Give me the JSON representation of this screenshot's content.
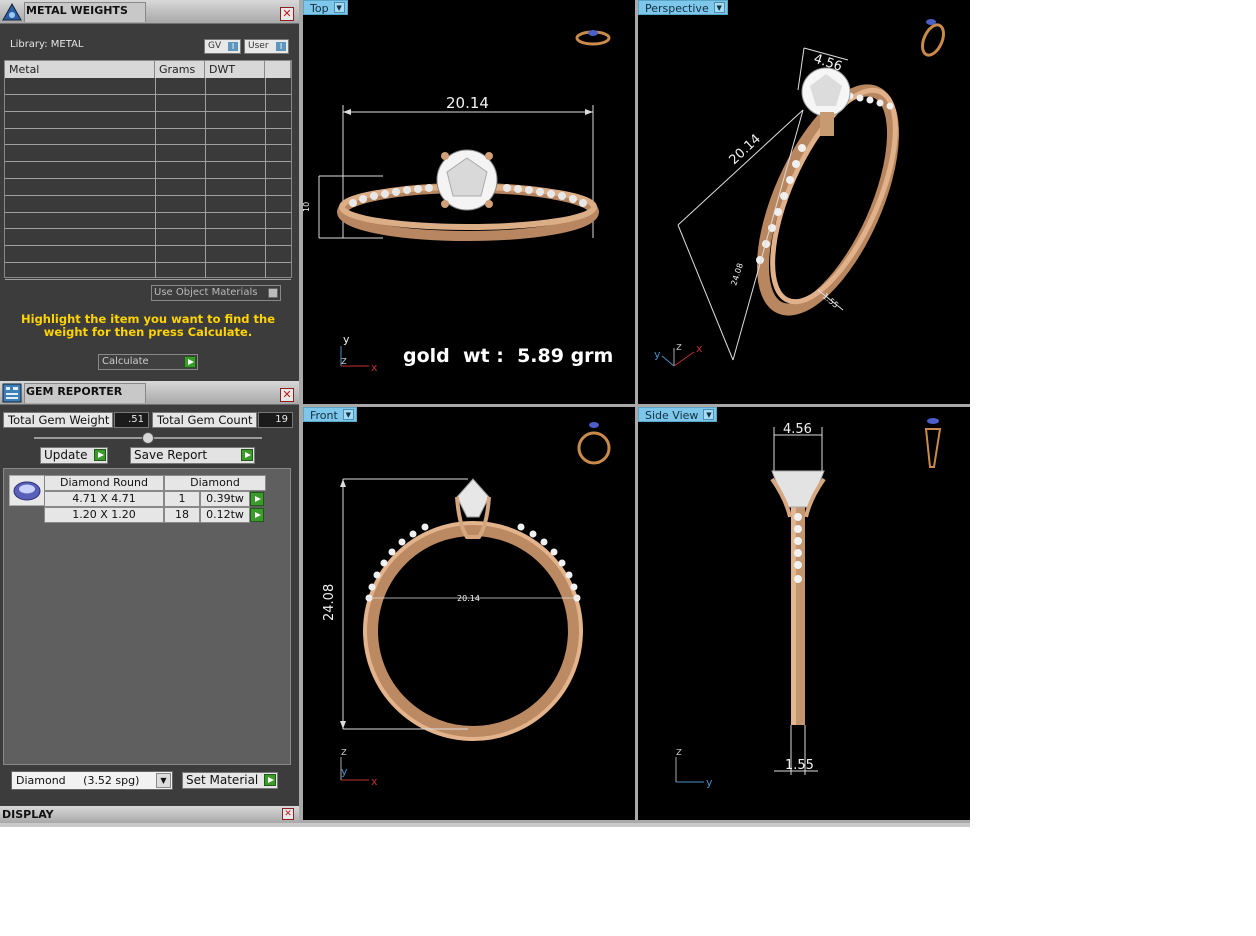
{
  "metal_weights": {
    "title": "METAL WEIGHTS",
    "library_label": "Library: METAL",
    "toggle_gv": "GV",
    "toggle_user": "User",
    "toggle_state": "I",
    "columns": [
      "Metal",
      "Grams",
      "DWT",
      ""
    ],
    "use_object_materials": "Use Object Materials",
    "hint": "Highlight the item you want to find the weight for then press Calculate.",
    "calculate_label": "Calculate"
  },
  "gem_reporter": {
    "title": "GEM REPORTER",
    "total_weight_label": "Total Gem Weight",
    "total_weight_value": ".51",
    "total_count_label": "Total Gem Count",
    "total_count_value": "19",
    "update_label": "Update",
    "save_report_label": "Save Report",
    "header": {
      "shape": "Diamond Round",
      "material": "Diamond"
    },
    "rows": [
      {
        "size": "4.71 X 4.71",
        "count": "1",
        "weight": "0.39tw"
      },
      {
        "size": "1.20 X 1.20",
        "count": "18",
        "weight": "0.12tw"
      }
    ],
    "material_select": "Diamond     (3.52 spg)",
    "set_material_label": "Set Material"
  },
  "display_bar": {
    "title": "DISPLAY"
  },
  "viewports": {
    "top": {
      "label": "Top",
      "dim_width": "20.14",
      "dim_height": "10",
      "gold_weight": "gold  wt :  5.89 grm",
      "axes": {
        "y": "y",
        "z": "z",
        "x": "x"
      }
    },
    "perspective": {
      "label": "Perspective",
      "dim_top": "4.56",
      "dim_diag": "20.14",
      "dim_side": "24.08",
      "dim_small": "1.55",
      "axes": {
        "y": "y",
        "z": "z",
        "x": "x"
      }
    },
    "front": {
      "label": "Front",
      "dim_height": "24.08",
      "dim_inner": "20.14",
      "axes": {
        "z": "z",
        "y": "y",
        "x": "x"
      }
    },
    "side": {
      "label": "Side View",
      "dim_top": "4.56",
      "dim_bottom": "1.55",
      "axes": {
        "z": "z",
        "y": "y"
      }
    }
  },
  "colors": {
    "gold": "#c99a6e",
    "hint_yellow": "#ffd400",
    "viewport_tab": "#7ec7ea",
    "accent_green": "#3c9a2c"
  }
}
